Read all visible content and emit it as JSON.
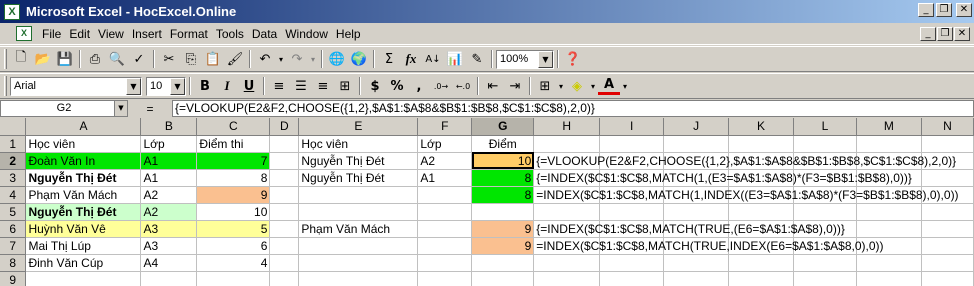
{
  "window": {
    "title": "Microsoft Excel - HocExcel.Online"
  },
  "menu": {
    "items": [
      "File",
      "Edit",
      "View",
      "Insert",
      "Format",
      "Tools",
      "Data",
      "Window",
      "Help"
    ]
  },
  "toolbar": {
    "zoom": "100%",
    "font": "Arial",
    "size": "10",
    "sum": "Σ",
    "fx": "fx"
  },
  "formula_bar": {
    "name_box": "G2",
    "eq": "=",
    "formula": "{=VLOOKUP(E2&F2,CHOOSE({1,2},$A$1:$A$8&$B$1:$B$8,$C$1:$C$8),2,0)}"
  },
  "columns": [
    "A",
    "B",
    "C",
    "D",
    "E",
    "F",
    "G",
    "H",
    "I",
    "J",
    "K",
    "L",
    "M",
    "N"
  ],
  "rows": [
    {
      "n": "1",
      "A": "Học viên",
      "B": "Lớp",
      "C": "Điểm thi",
      "E": "Học viên",
      "F": "Lớp",
      "G": "Điểm",
      "H": ""
    },
    {
      "n": "2",
      "A": "Đoàn Văn In",
      "B": "A1",
      "C": "7",
      "E": "Nguyễn Thị Đét",
      "F": "A2",
      "G": "10",
      "H": "{=VLOOKUP(E2&F2,CHOOSE({1,2},$A$1:$A$8&$B$1:$B$8,$C$1:$C$8),2,0)}"
    },
    {
      "n": "3",
      "A": "Nguyễn Thị Đét",
      "B": "A1",
      "C": "8",
      "E": "Nguyễn Thị Đét",
      "F": "A1",
      "G": "8",
      "H": "{=INDEX($C$1:$C$8,MATCH(1,(E3=$A$1:$A$8)*(F3=$B$1:$B$8),0))}"
    },
    {
      "n": "4",
      "A": "Phạm Văn Mách",
      "B": "A2",
      "C": "9",
      "E": "",
      "F": "",
      "G": "8",
      "H": "=INDEX($C$1:$C$8,MATCH(1,INDEX((E3=$A$1:$A$8)*(F3=$B$1:$B$8),0),0))"
    },
    {
      "n": "5",
      "A": "Nguyễn Thị Đét",
      "B": "A2",
      "C": "10",
      "E": "",
      "F": "",
      "G": "",
      "H": ""
    },
    {
      "n": "6",
      "A": "Huỳnh Văn Vê",
      "B": "A3",
      "C": "5",
      "E": "Phạm Văn Mách",
      "F": "",
      "G": "9",
      "H": "{=INDEX($C$1:$C$8,MATCH(TRUE,(E6=$A$1:$A$8),0))}"
    },
    {
      "n": "7",
      "A": "Mai Thị Lúp",
      "B": "A3",
      "C": "6",
      "E": "",
      "F": "",
      "G": "9",
      "H": "=INDEX($C$1:$C$8,MATCH(TRUE,INDEX(E6=$A$1:$A$8,0),0))"
    },
    {
      "n": "8",
      "A": "Đinh Văn Cúp",
      "B": "A4",
      "C": "4",
      "E": "",
      "F": "",
      "G": "",
      "H": ""
    },
    {
      "n": "9",
      "A": "",
      "B": "",
      "C": "",
      "E": "",
      "F": "",
      "G": "",
      "H": ""
    }
  ],
  "colors": {
    "green": "#00e600",
    "light_green": "#ccffcc",
    "yellow": "#ffff99",
    "peach": "#fac090",
    "selected": "#ffcc66"
  }
}
